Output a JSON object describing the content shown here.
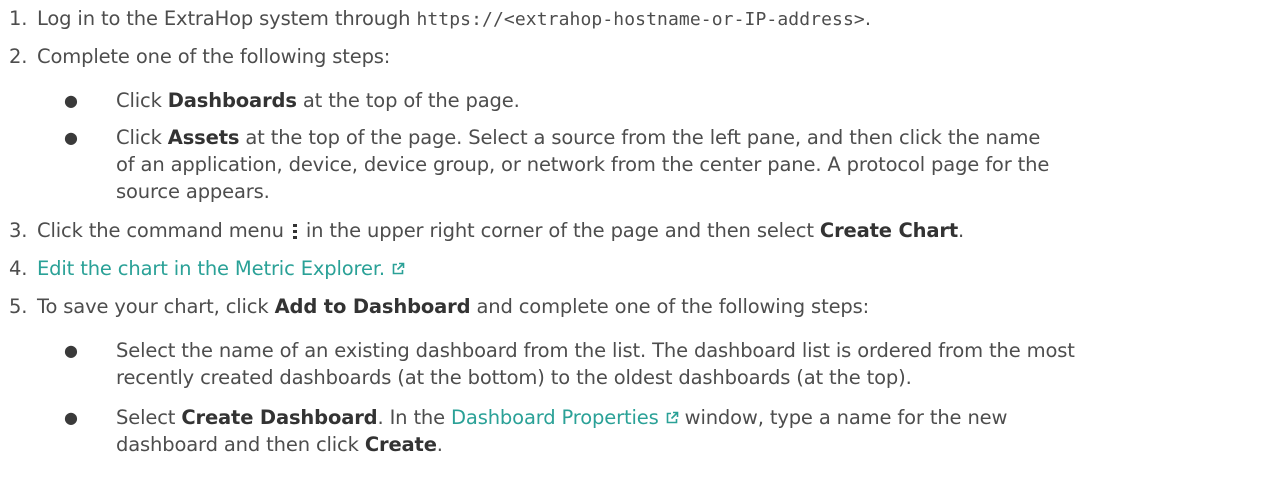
{
  "steps": [
    {
      "number": "1.",
      "parts": [
        "Log in to the ExtraHop system through ",
        "https://<extrahop-hostname-or-IP-address>",
        "."
      ]
    },
    {
      "number": "2.",
      "text": "Complete one of the following steps:",
      "bullets": [
        {
          "pre": "Click ",
          "bold": "Dashboards",
          "post": " at the top of the page."
        },
        {
          "pre": "Click ",
          "bold": "Assets",
          "post_line1": " at the top of the page. Select a source from the left pane, and then click the name",
          "line2": "of an application, device, device group, or network from the center pane. A protocol page for the",
          "line3": "source appears."
        }
      ]
    },
    {
      "number": "3.",
      "pre": "Click the command menu ",
      "icon": "command-menu-kebab-icon",
      "mid": " in the upper right corner of the page and then select ",
      "bold": "Create Chart",
      "post": "."
    },
    {
      "number": "4.",
      "link": "Edit the chart in the Metric Explorer.",
      "icon": "external-link-icon"
    },
    {
      "number": "5.",
      "pre": "To save your chart, click ",
      "bold": "Add to Dashboard",
      "post": " and complete one of the following steps:",
      "bullets": [
        {
          "line1": "Select the name of an existing dashboard from the list. The dashboard list is ordered from the most",
          "line2": "recently created dashboards (at the bottom) to the oldest dashboards (at the top)."
        },
        {
          "pre": "Select ",
          "bold": "Create Dashboard",
          "mid": ". In the ",
          "link": "Dashboard Properties",
          "icon": "external-link-icon",
          "post_line1": " window, type a name for the new",
          "line2_pre": "dashboard and then click ",
          "line2_bold": "Create",
          "line2_post": "."
        }
      ]
    }
  ],
  "colors": {
    "text": "#4d4d4d",
    "bold": "#333333",
    "link": "#2aa197"
  }
}
